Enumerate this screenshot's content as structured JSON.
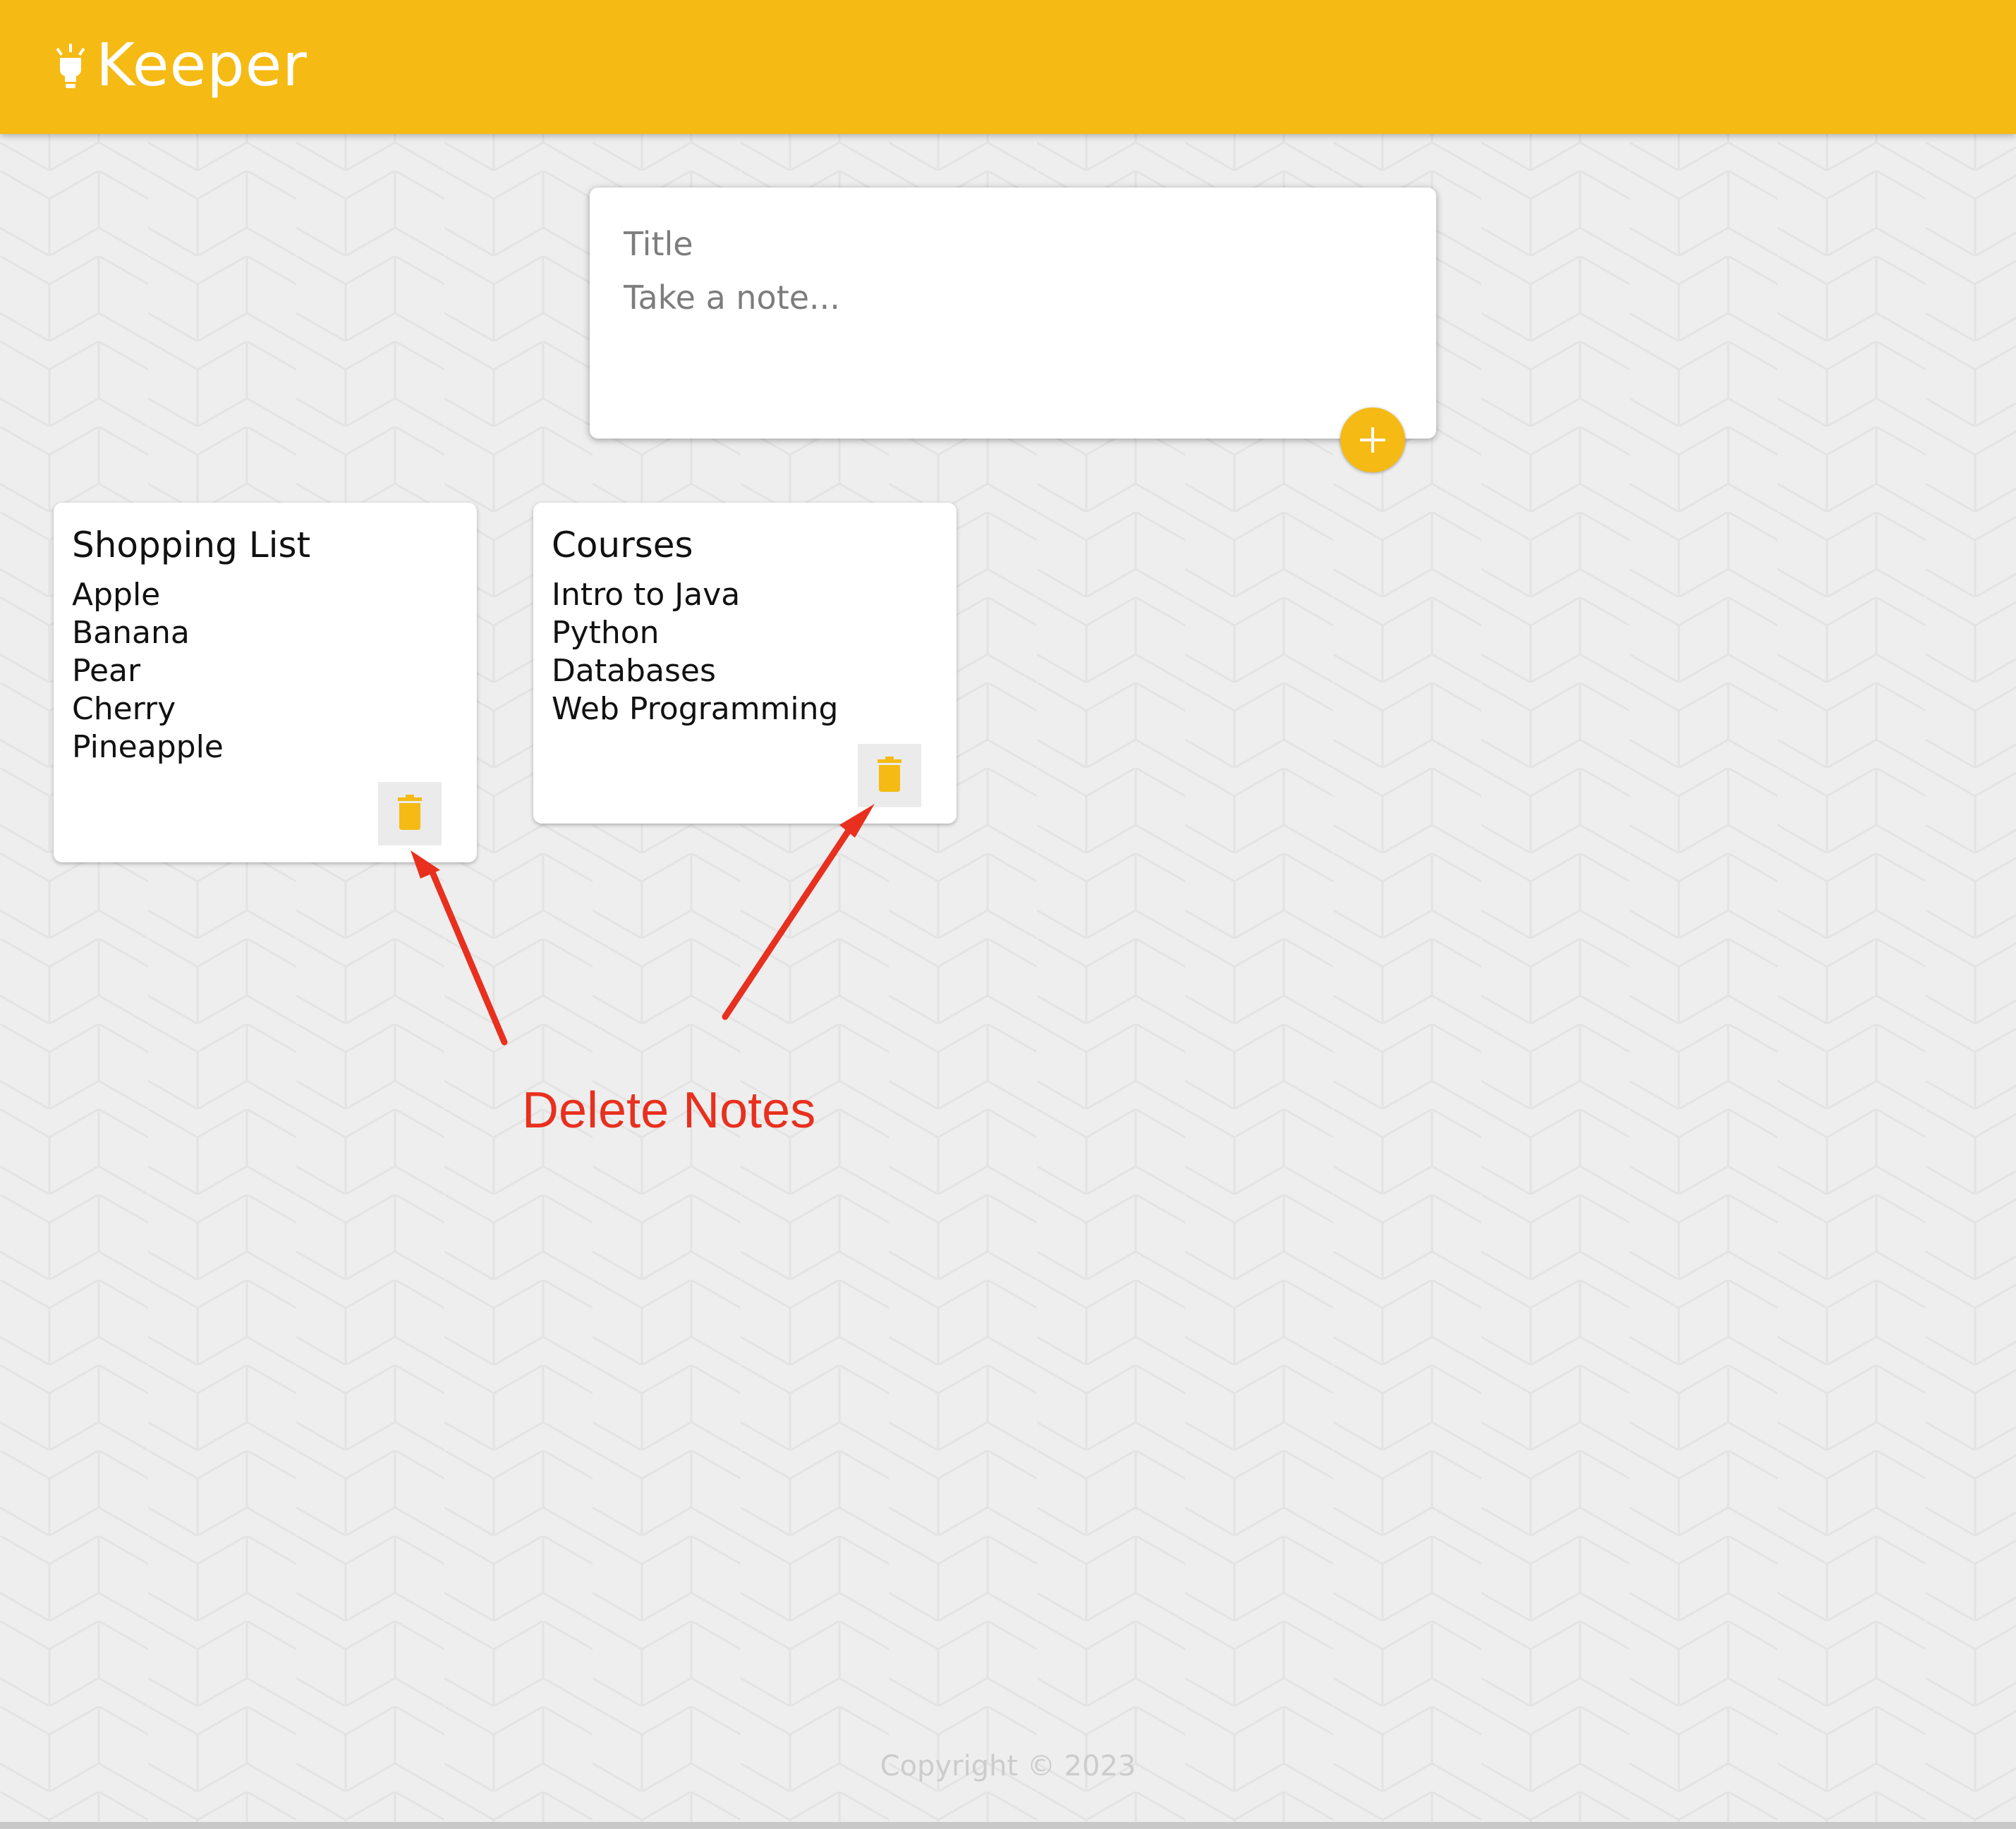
{
  "header": {
    "logo_text": "Keeper",
    "icon": "lightbulb-icon",
    "background_color": "#f5ba13"
  },
  "create_note": {
    "title_placeholder": "Title",
    "content_placeholder": "Take a note...",
    "add_button_icon": "plus-icon"
  },
  "notes": [
    {
      "title": "Shopping List",
      "lines": [
        "Apple",
        "Banana",
        "Pear",
        "Cherry",
        "Pineapple"
      ],
      "delete_icon": "trash-icon"
    },
    {
      "title": "Courses",
      "lines": [
        "Intro to Java",
        "Python",
        "Databases",
        "Web Programming"
      ],
      "delete_icon": "trash-icon"
    }
  ],
  "annotation": {
    "text": "Delete Notes",
    "color": "#e8301e"
  },
  "footer": {
    "copyright": "Copyright © 2023"
  },
  "colors": {
    "accent": "#f5ba13",
    "background": "#eeeeee"
  }
}
